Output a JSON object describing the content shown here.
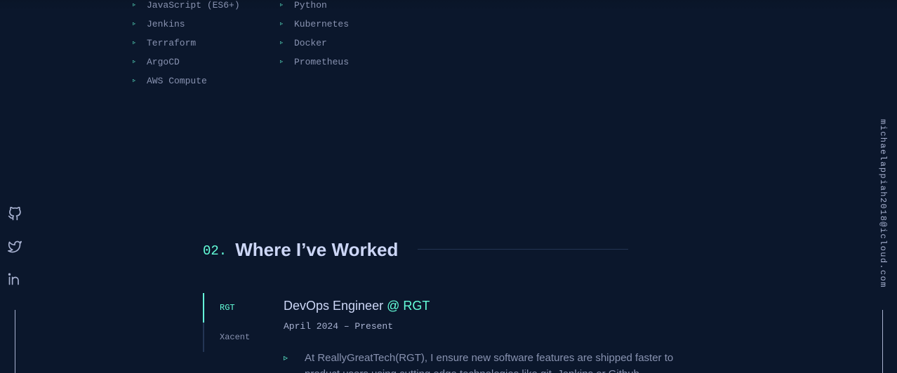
{
  "skills": {
    "bullet_icon": "triangle-right-icon",
    "items": [
      "JavaScript (ES6+)",
      "Python",
      "Jenkins",
      "Kubernetes",
      "Terraform",
      "Docker",
      "ArgoCD",
      "Prometheus",
      "AWS Compute"
    ]
  },
  "social": {
    "icons": [
      "github-icon",
      "twitter-icon",
      "linkedin-icon"
    ]
  },
  "email": "michaelappiah2018@icloud.com",
  "experience": {
    "number": "02.",
    "title": "Where I’ve Worked",
    "tabs": [
      "RGT",
      "Xacent"
    ],
    "active_tab": "RGT",
    "job": {
      "role": "DevOps Engineer",
      "company": "@ RGT",
      "dates": "April 2024 – Present",
      "bullets": [
        "At ReallyGreatTech(RGT), I ensure new software features are shipped faster to product users using cutting edge technologies like git, Jenkins or Github"
      ]
    }
  },
  "colors": {
    "background": "#0b172c",
    "accent": "#64ffda",
    "heading": "#ccd6f6",
    "text": "#8892b0"
  }
}
